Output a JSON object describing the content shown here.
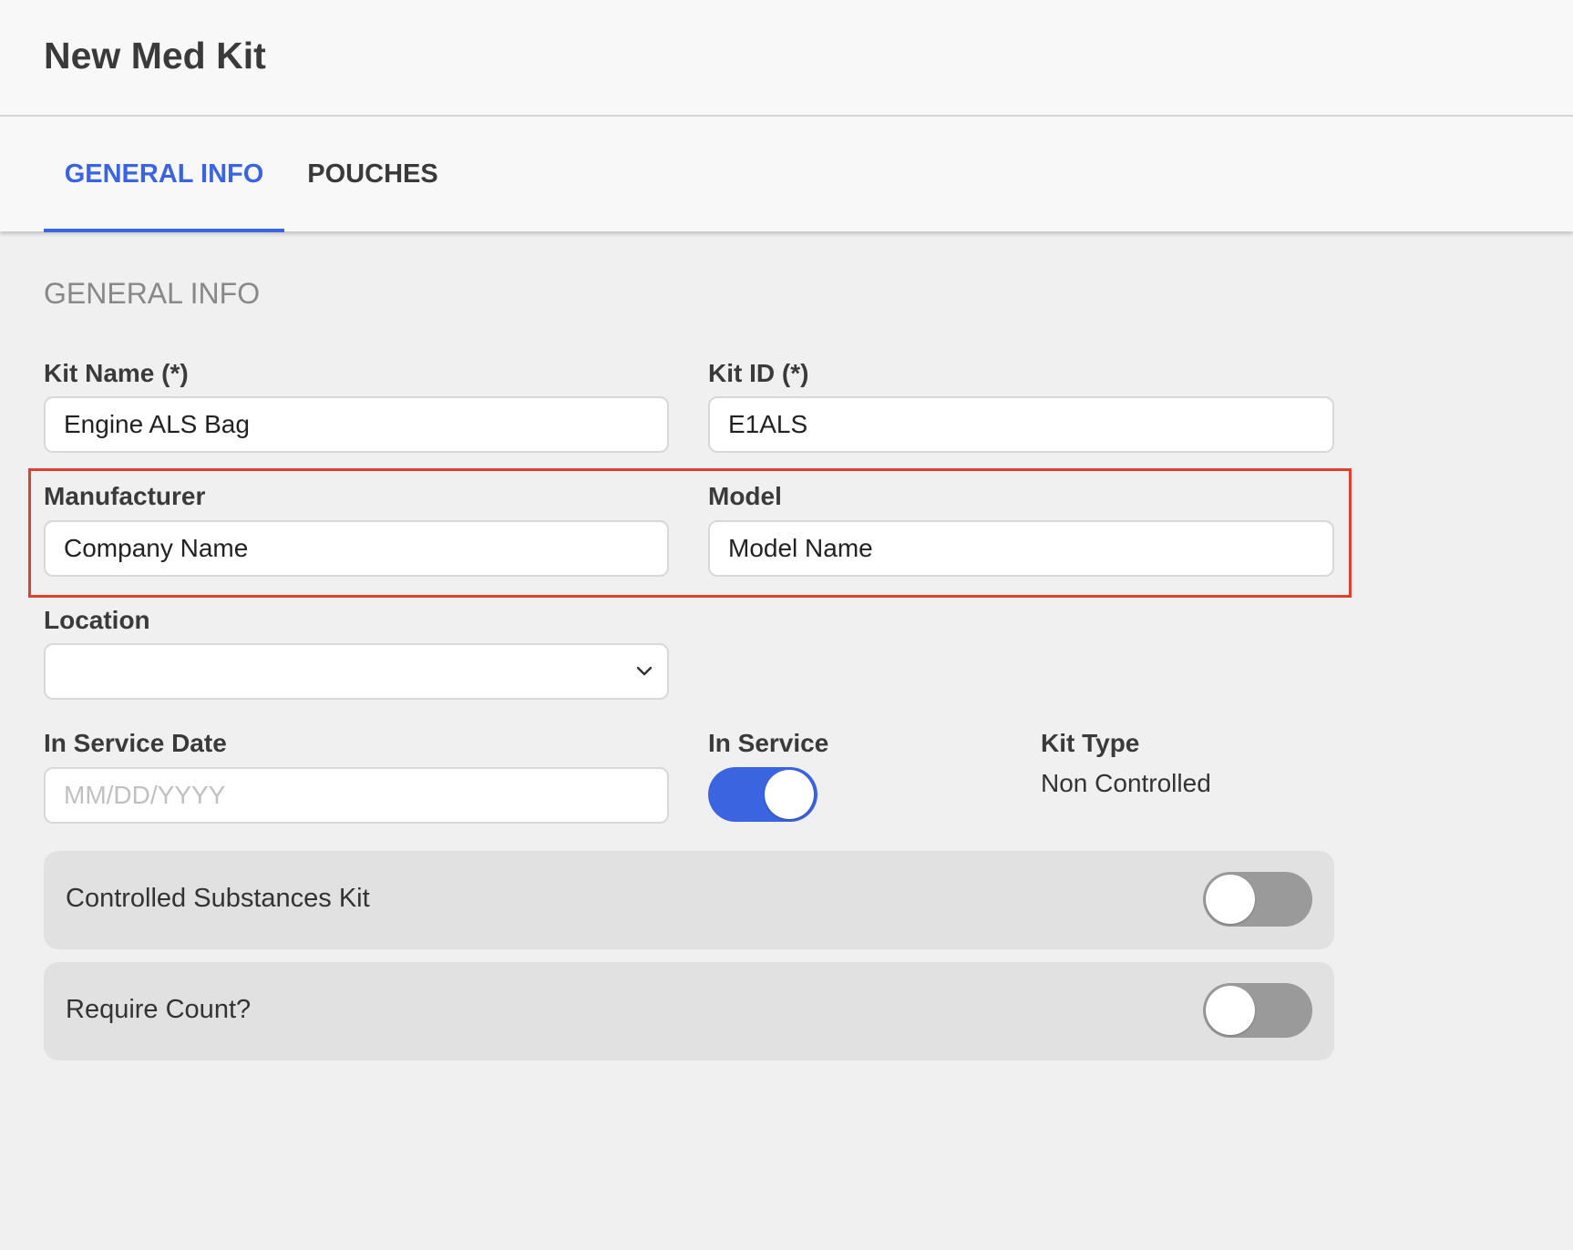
{
  "header": {
    "title": "New Med Kit"
  },
  "tabs": [
    {
      "label": "GENERAL INFO",
      "active": true
    },
    {
      "label": "POUCHES",
      "active": false
    }
  ],
  "section": {
    "title": "GENERAL INFO"
  },
  "form": {
    "kit_name": {
      "label": "Kit Name (*)",
      "value": "Engine ALS Bag"
    },
    "kit_id": {
      "label": "Kit ID (*)",
      "value": "E1ALS"
    },
    "manufacturer": {
      "label": "Manufacturer",
      "value": "Company Name"
    },
    "model": {
      "label": "Model",
      "value": "Model Name"
    },
    "location": {
      "label": "Location",
      "value": ""
    },
    "in_service_date": {
      "label": "In Service Date",
      "value": "",
      "placeholder": "MM/DD/YYYY"
    },
    "in_service": {
      "label": "In Service",
      "on": true
    },
    "kit_type": {
      "label": "Kit Type",
      "value": "Non Controlled"
    },
    "controlled_substances": {
      "label": "Controlled Substances Kit",
      "on": false
    },
    "require_count": {
      "label": "Require Count?",
      "on": false
    }
  },
  "colors": {
    "accent": "#3b64e0",
    "highlight": "#e0402f",
    "toggle_off": "#9a9a9a"
  },
  "icons": {
    "location_dropdown": "chevron-down-icon"
  }
}
